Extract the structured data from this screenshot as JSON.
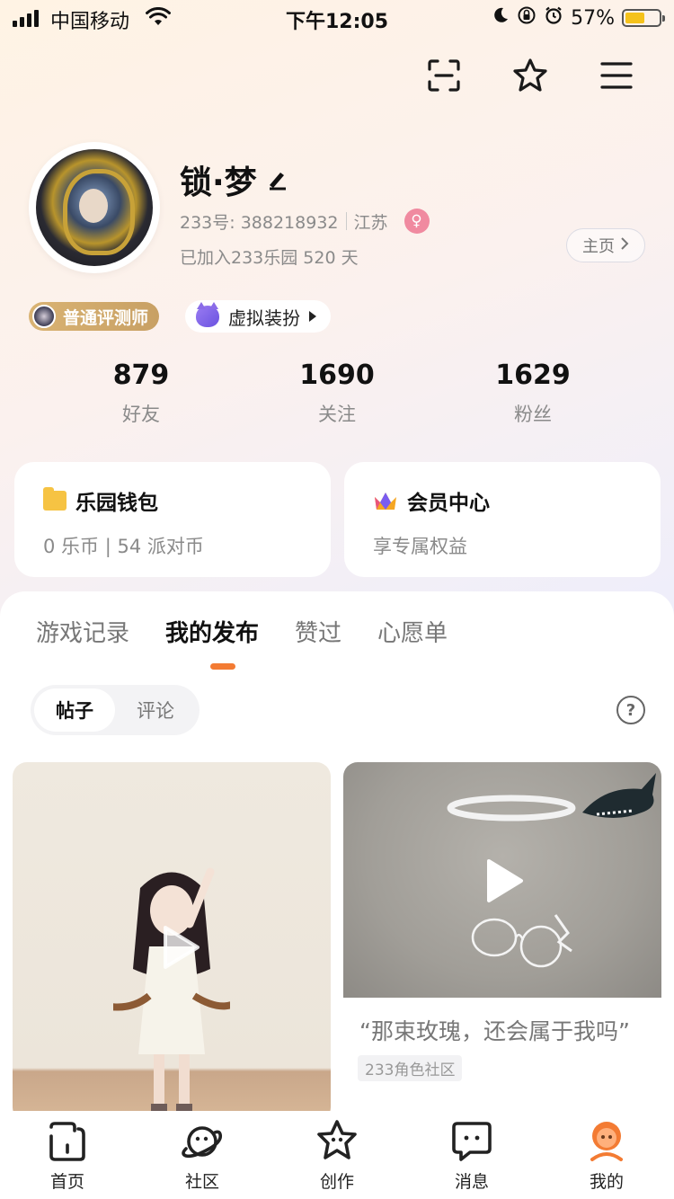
{
  "status_bar": {
    "carrier": "中国移动",
    "time": "下午12:05",
    "battery_percent": "57%",
    "battery_level": 0.57
  },
  "header": {
    "icons": [
      "scan-icon",
      "star-outline-icon",
      "menu-icon"
    ]
  },
  "profile": {
    "username": "锁·梦",
    "uid_label": "233号: 388218932",
    "region": "江苏",
    "gender_symbol": "♀",
    "joined": "已加入233乐园 520 天",
    "home_button": "主页"
  },
  "badges": {
    "tester": "普通评测师",
    "dress_up": "虚拟装扮"
  },
  "stats": [
    {
      "value": "879",
      "label": "好友"
    },
    {
      "value": "1690",
      "label": "关注"
    },
    {
      "value": "1629",
      "label": "粉丝"
    }
  ],
  "cards": {
    "wallet": {
      "title": "乐园钱包",
      "subtitle": "0 乐币 | 54 派对币"
    },
    "vip": {
      "title": "会员中心",
      "subtitle": "享专属权益"
    }
  },
  "tabs": [
    {
      "label": "游戏记录",
      "active": false
    },
    {
      "label": "我的发布",
      "active": true
    },
    {
      "label": "赞过",
      "active": false
    },
    {
      "label": "心愿单",
      "active": false
    }
  ],
  "segments": [
    {
      "label": "帖子",
      "active": true
    },
    {
      "label": "评论",
      "active": false
    }
  ],
  "help_symbol": "?",
  "posts": [
    {
      "kind": "video"
    },
    {
      "kind": "video",
      "title": "“那束玫瑰，还会属于我吗”",
      "tag": "233角色社区"
    }
  ],
  "bottom_nav": [
    {
      "label": "首页",
      "icon": "home-icon",
      "active": false
    },
    {
      "label": "社区",
      "icon": "planet-icon",
      "active": false
    },
    {
      "label": "创作",
      "icon": "star-face-icon",
      "active": false
    },
    {
      "label": "消息",
      "icon": "chat-icon",
      "active": false
    },
    {
      "label": "我的",
      "icon": "profile-avatar-icon",
      "active": true
    }
  ],
  "colors": {
    "accent": "#f37b33",
    "tester_badge": "#d4ad6c",
    "gender_badge": "#f08aa0",
    "wallet": "#f6c343"
  }
}
